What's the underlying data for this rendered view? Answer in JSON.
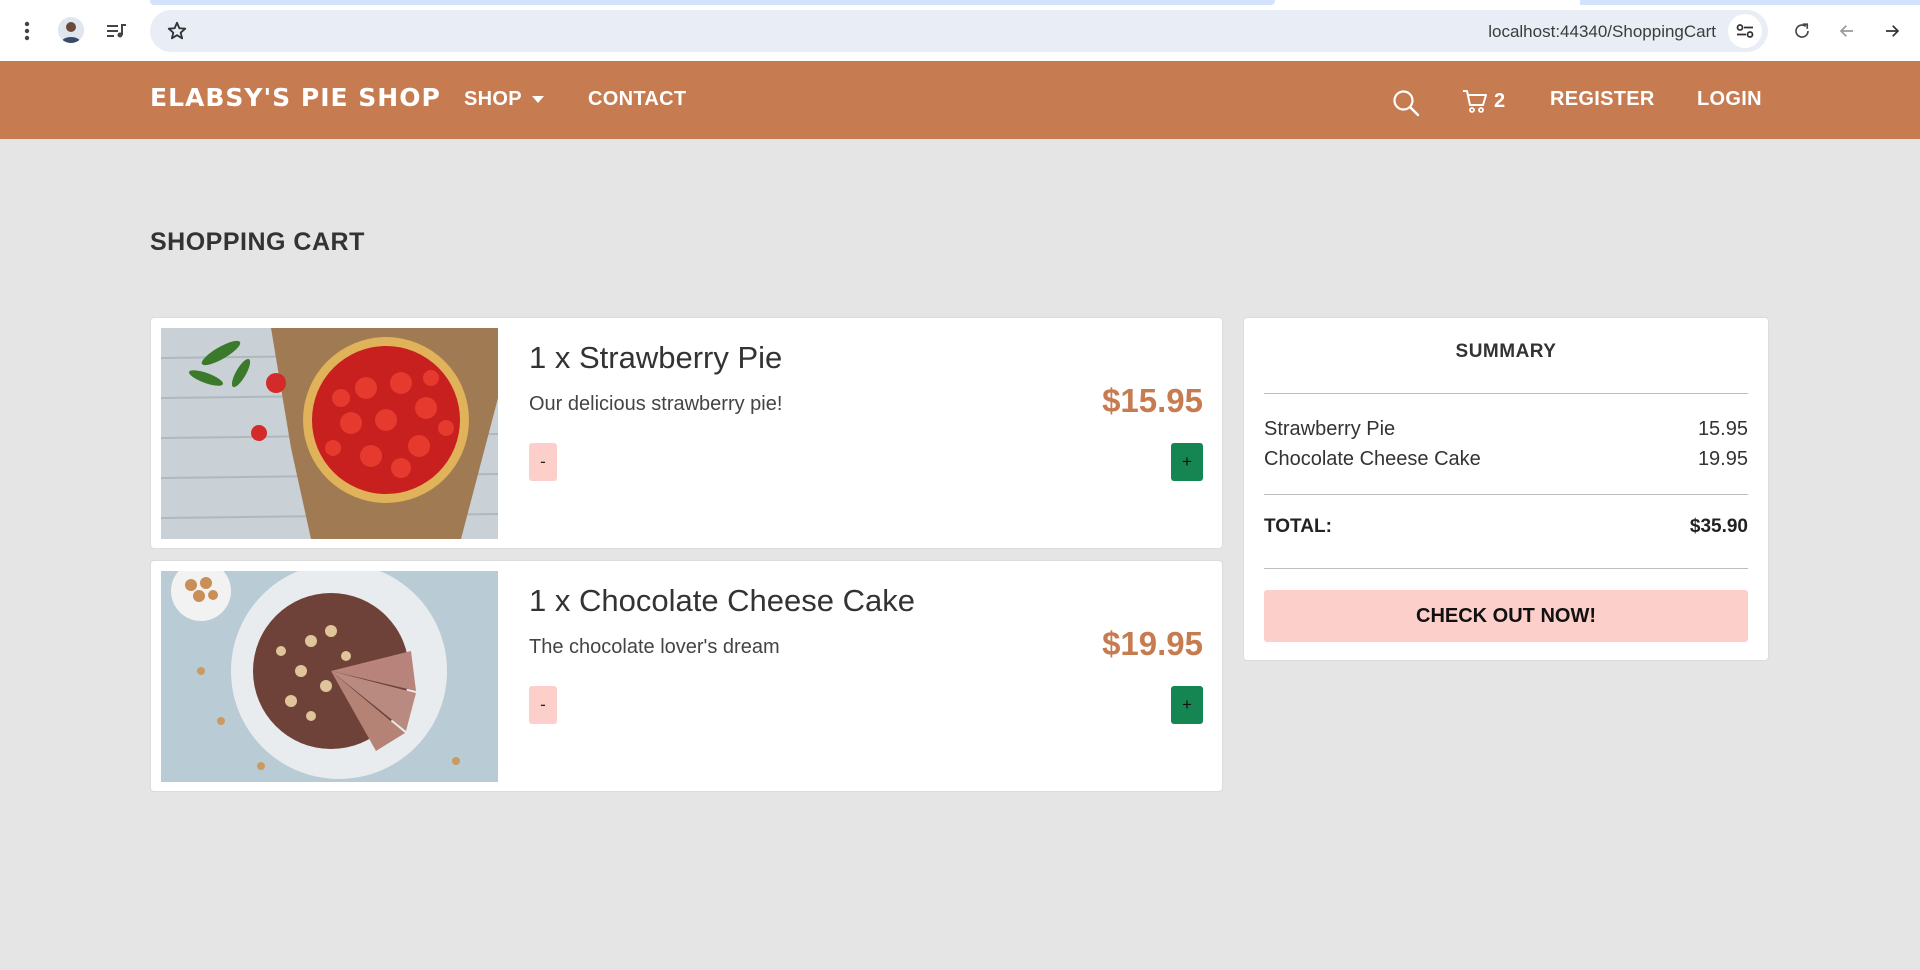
{
  "browser": {
    "url": "localhost:44340/ShoppingCart"
  },
  "nav": {
    "brand": "ELABSY'S PIE SHOP",
    "shop": "SHOP",
    "contact": "CONTACT",
    "cart_count": "2",
    "register": "REGISTER",
    "login": "LOGIN"
  },
  "page": {
    "title": "SHOPPING CART"
  },
  "cart": {
    "items": [
      {
        "name": "1 x Strawberry Pie",
        "description": "Our delicious strawberry pie!",
        "price": "$15.95",
        "minus": "-",
        "plus": "+"
      },
      {
        "name": "1 x Chocolate Cheese Cake",
        "description": "The chocolate lover's dream",
        "price": "$19.95",
        "minus": "-",
        "plus": "+"
      }
    ]
  },
  "summary": {
    "title": "SUMMARY",
    "lines": [
      {
        "name": "Strawberry Pie",
        "amount": "15.95"
      },
      {
        "name": "Chocolate Cheese Cake",
        "amount": "19.95"
      }
    ],
    "total_label": "TOTAL:",
    "total_value": "$35.90",
    "checkout": "CHECK OUT NOW!"
  },
  "colors": {
    "nav_bg": "#c77b51",
    "price": "#c77b51",
    "minus_bg": "#fccfca",
    "plus_bg": "#158552",
    "page_bg": "#e5e5e5"
  }
}
